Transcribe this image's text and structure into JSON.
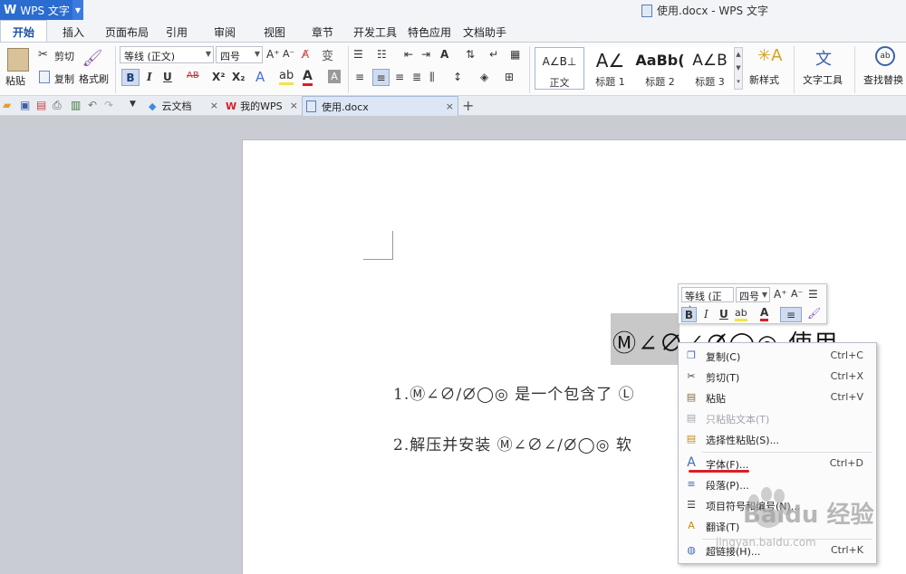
{
  "app": {
    "logo": "W",
    "name": "WPS 文字",
    "window_title": "使用.docx - WPS 文字"
  },
  "menu_tabs": [
    "开始",
    "插入",
    "页面布局",
    "引用",
    "审阅",
    "视图",
    "章节",
    "开发工具",
    "特色应用",
    "文档助手"
  ],
  "ribbon": {
    "paste": "粘贴",
    "cut": "剪切",
    "copy": "复制",
    "format_painter": "格式刷",
    "font_name": "等线 (正文)",
    "font_size": "四号",
    "bold": "B",
    "italic": "I",
    "underline": "U",
    "strike": "AB",
    "superscript": "X²",
    "subscript": "X₂",
    "styles": [
      {
        "glyph": "A∠B⊥",
        "label": "正文"
      },
      {
        "glyph": "A∠",
        "label": "标题 1"
      },
      {
        "glyph": "AaBb(",
        "label": "标题 2"
      },
      {
        "glyph": "A∠B",
        "label": "标题 3"
      }
    ],
    "new_style": "新样式",
    "text_tools": "文字工具",
    "find_replace": "查找替换"
  },
  "doc_tabs": [
    {
      "label": "云文档"
    },
    {
      "label": "我的WPS"
    },
    {
      "label": "使用.docx"
    }
  ],
  "document": {
    "heading": "Ⓜ∠∅∠∅̸◯◎ 使用",
    "line1": "1.Ⓜ∠∅∕∅̸◯◎ 是一个包含了 Ⓛ",
    "line2": "2.解压并安装 Ⓜ∠∅∠∕∅̸◯◎ 软"
  },
  "mini_toolbar": {
    "font_name": "等线 (正文",
    "font_size": "四号"
  },
  "context_menu": [
    {
      "icon": "copy-icon",
      "label": "复制(C)",
      "shortcut": "Ctrl+C",
      "disabled": false
    },
    {
      "icon": "scissors-icon",
      "label": "剪切(T)",
      "shortcut": "Ctrl+X",
      "disabled": false
    },
    {
      "icon": "paste-icon",
      "label": "粘贴",
      "shortcut": "Ctrl+V",
      "disabled": false
    },
    {
      "icon": "paste-text-icon",
      "label": "只粘贴文本(T)",
      "shortcut": "",
      "disabled": true
    },
    {
      "icon": "paste-special-icon",
      "label": "选择性粘贴(S)...",
      "shortcut": "",
      "disabled": false
    },
    {
      "icon": "font-icon",
      "label": "字体(F)...",
      "shortcut": "Ctrl+D",
      "disabled": false
    },
    {
      "icon": "paragraph-icon",
      "label": "段落(P)...",
      "shortcut": "",
      "disabled": false
    },
    {
      "icon": "bullets-icon",
      "label": "项目符号和编号(N)...",
      "shortcut": "",
      "disabled": false
    },
    {
      "icon": "translate-icon",
      "label": "翻译(T)",
      "shortcut": "",
      "disabled": false
    },
    {
      "icon": "hyperlink-icon",
      "label": "超链接(H)...",
      "shortcut": "Ctrl+K",
      "disabled": false
    }
  ],
  "watermark": {
    "text": "Baidu 经验",
    "url": "jingyan.baidu.com"
  },
  "colors": {
    "accent": "#2a6ccf",
    "highlight_underline": "#d81f26",
    "font_color": "#d81f26"
  }
}
